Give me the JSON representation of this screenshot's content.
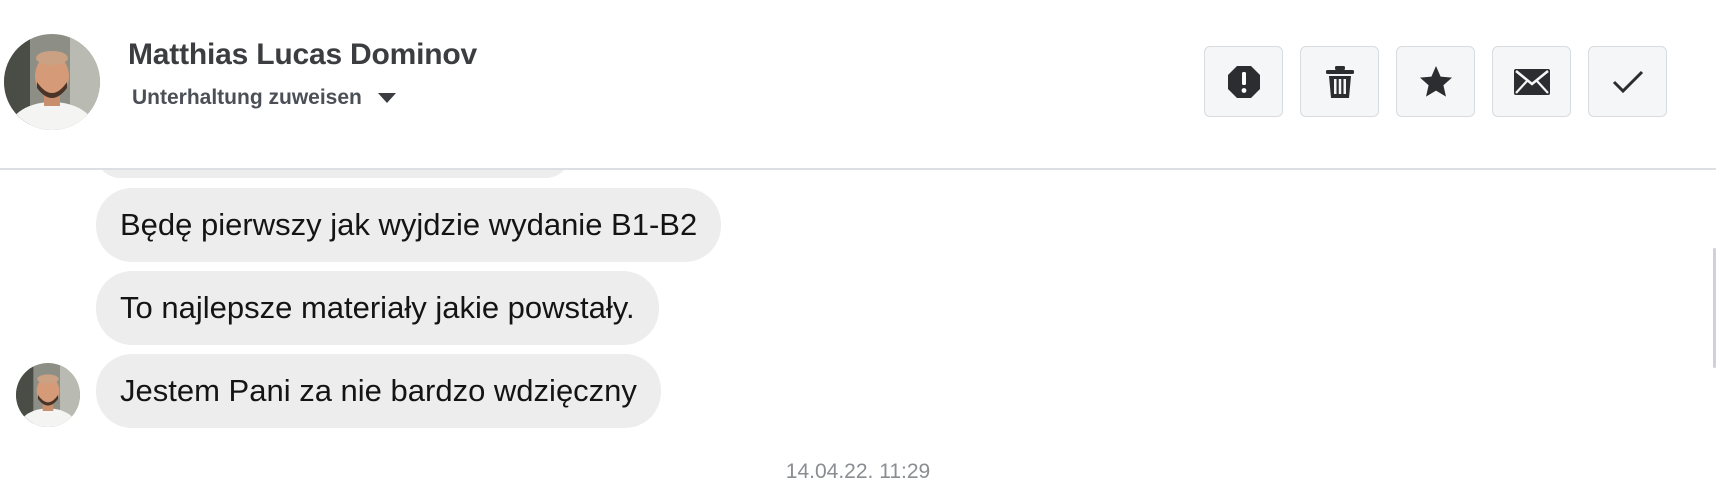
{
  "header": {
    "contact_name": "Matthias Lucas Dominov",
    "assign_label": "Unterhaltung zuweisen",
    "actions": [
      {
        "name": "report-spam",
        "icon": "alert-octagon-icon"
      },
      {
        "name": "delete",
        "icon": "trash-icon"
      },
      {
        "name": "star",
        "icon": "star-icon"
      },
      {
        "name": "mark-unread",
        "icon": "envelope-icon"
      },
      {
        "name": "mark-done",
        "icon": "checkmark-icon"
      }
    ]
  },
  "messages": [
    {
      "text": "Będę pierwszy jak wyjdzie wydanie B1-B2"
    },
    {
      "text": "To najlepsze materiały jakie powstały."
    },
    {
      "text": "Jestem Pani za nie bardzo wdzięczny"
    }
  ],
  "timestamp": "14.04.22. 11:29",
  "colors": {
    "bubble_bg": "#ededed",
    "header_border": "#dcdfe3",
    "button_bg": "#f5f6f7",
    "icon": "#2b2d30",
    "timestamp": "#8a8d91"
  }
}
